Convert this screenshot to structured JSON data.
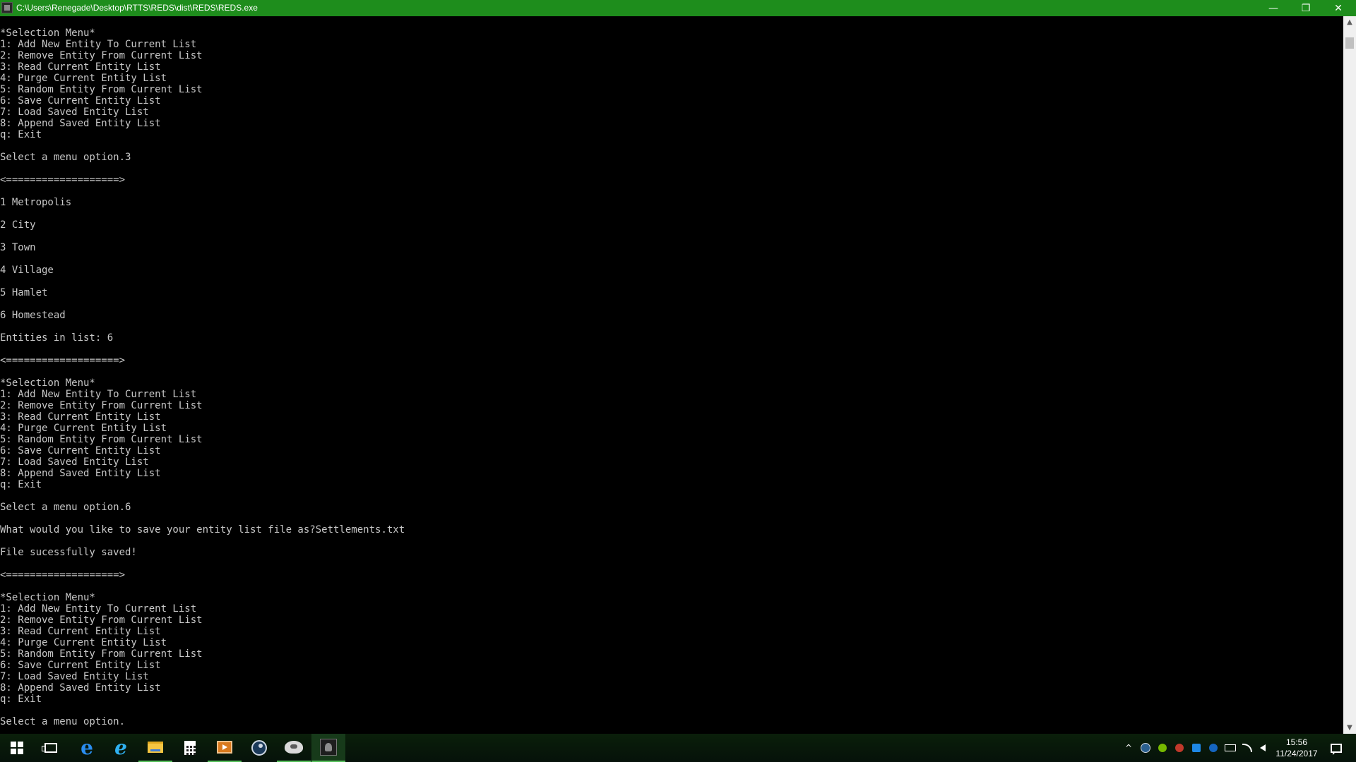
{
  "window": {
    "title": "C:\\Users\\Renegade\\Desktop\\RTTS\\REDS\\dist\\REDS\\REDS.exe",
    "minimize_glyph": "—",
    "maximize_glyph": "❐",
    "close_glyph": "✕",
    "title_bar_color": "#1e8d1c"
  },
  "console": {
    "text_color": "#c8c8c8",
    "background": "#000000",
    "lines": [
      "*Selection Menu*",
      "1: Add New Entity To Current List",
      "2: Remove Entity From Current List",
      "3: Read Current Entity List",
      "4: Purge Current Entity List",
      "5: Random Entity From Current List",
      "6: Save Current Entity List",
      "7: Load Saved Entity List",
      "8: Append Saved Entity List",
      "q: Exit",
      "",
      "Select a menu option.3",
      "",
      "<===================>",
      "",
      "1 Metropolis",
      "",
      "2 City",
      "",
      "3 Town",
      "",
      "4 Village",
      "",
      "5 Hamlet",
      "",
      "6 Homestead",
      "",
      "Entities in list: 6",
      "",
      "<===================>",
      "",
      "*Selection Menu*",
      "1: Add New Entity To Current List",
      "2: Remove Entity From Current List",
      "3: Read Current Entity List",
      "4: Purge Current Entity List",
      "5: Random Entity From Current List",
      "6: Save Current Entity List",
      "7: Load Saved Entity List",
      "8: Append Saved Entity List",
      "q: Exit",
      "",
      "Select a menu option.6",
      "",
      "What would you like to save your entity list file as?Settlements.txt",
      "",
      "File sucessfully saved!",
      "",
      "<===================>",
      "",
      "*Selection Menu*",
      "1: Add New Entity To Current List",
      "2: Remove Entity From Current List",
      "3: Read Current Entity List",
      "4: Purge Current Entity List",
      "5: Random Entity From Current List",
      "6: Save Current Entity List",
      "7: Load Saved Entity List",
      "8: Append Saved Entity List",
      "q: Exit",
      "",
      "Select a menu option."
    ]
  },
  "scrollbar": {
    "up_glyph": "▲",
    "down_glyph": "▼"
  },
  "taskbar": {
    "pinned_icons": [
      "windows-start-icon",
      "task-view-icon",
      "edge-icon",
      "internet-explorer-icon",
      "file-explorer-icon",
      "calculator-icon",
      "media-player-icon",
      "steam-icon",
      "drone-app-icon",
      "reds-console-icon"
    ],
    "edge_glyph": "e",
    "ie_glyph": "e",
    "tray_icons": [
      "show-hidden-icons-chevron",
      "steam-tray-icon",
      "nvidia-tray-icon",
      "security-tray-icon",
      "dropbox-tray-icon",
      "bluetooth-tray-icon",
      "power-tray-icon",
      "network-tray-icon",
      "volume-tray-icon"
    ],
    "tray_chevron_glyph": "^",
    "time": "15:56",
    "date": "11/24/2017"
  }
}
